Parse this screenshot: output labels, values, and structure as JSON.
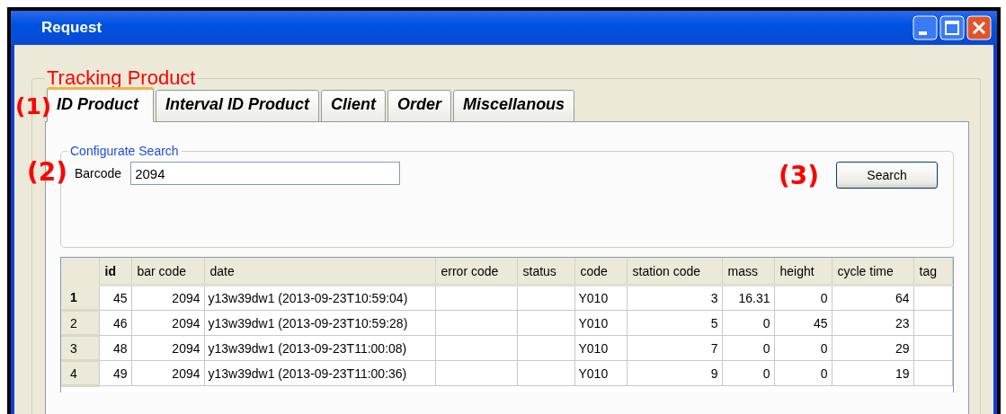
{
  "window": {
    "title": "Request"
  },
  "group": {
    "title": "Tracking Product"
  },
  "tabs": [
    {
      "label": "ID Product",
      "selected": true
    },
    {
      "label": "Interval ID Product",
      "selected": false
    },
    {
      "label": "Client",
      "selected": false
    },
    {
      "label": "Order",
      "selected": false
    },
    {
      "label": "Miscellanous",
      "selected": false
    }
  ],
  "search_group": {
    "title": "Configurate Search",
    "barcode_label": "Barcode",
    "barcode_value": "2094",
    "button": "Search"
  },
  "table": {
    "columns": [
      {
        "label": "id",
        "kind": "number",
        "selected": true
      },
      {
        "label": "bar code",
        "kind": "number",
        "selected": false
      },
      {
        "label": "date",
        "kind": "text",
        "selected": false
      },
      {
        "label": "error code",
        "kind": "text",
        "selected": false
      },
      {
        "label": "status",
        "kind": "text",
        "selected": false
      },
      {
        "label": "code",
        "kind": "text",
        "selected": false
      },
      {
        "label": "station code",
        "kind": "number",
        "selected": false
      },
      {
        "label": "mass",
        "kind": "number",
        "selected": false
      },
      {
        "label": "height",
        "kind": "number",
        "selected": false
      },
      {
        "label": "cycle time",
        "kind": "number",
        "selected": false
      },
      {
        "label": "tag",
        "kind": "text",
        "selected": false
      }
    ],
    "rows": [
      {
        "header": "1",
        "selected": true,
        "cells": [
          "45",
          "2094",
          "y13w39dw1 (2013-09-23T10:59:04)",
          "",
          "",
          "Y010",
          "3",
          "16.31",
          "0",
          "64",
          ""
        ]
      },
      {
        "header": "2",
        "selected": false,
        "cells": [
          "46",
          "2094",
          "y13w39dw1 (2013-09-23T10:59:28)",
          "",
          "",
          "Y010",
          "5",
          "0",
          "45",
          "23",
          ""
        ]
      },
      {
        "header": "3",
        "selected": false,
        "cells": [
          "48",
          "2094",
          "y13w39dw1 (2013-09-23T11:00:08)",
          "",
          "",
          "Y010",
          "7",
          "0",
          "0",
          "29",
          ""
        ]
      },
      {
        "header": "4",
        "selected": false,
        "cells": [
          "49",
          "2094",
          "y13w39dw1 (2013-09-23T11:00:36)",
          "",
          "",
          "Y010",
          "9",
          "0",
          "0",
          "19",
          ""
        ]
      }
    ]
  },
  "annotations": [
    {
      "label": "(1)"
    },
    {
      "label": "(2)"
    },
    {
      "label": "(3)"
    }
  ]
}
